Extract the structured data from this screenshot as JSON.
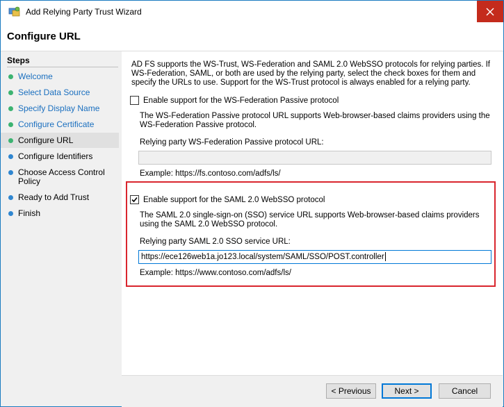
{
  "window": {
    "title": "Add Relying Party Trust Wizard"
  },
  "header": {
    "title": "Configure URL"
  },
  "sidebar": {
    "heading": "Steps",
    "steps": [
      {
        "label": "Welcome",
        "state": "done"
      },
      {
        "label": "Select Data Source",
        "state": "done"
      },
      {
        "label": "Specify Display Name",
        "state": "done"
      },
      {
        "label": "Configure Certificate",
        "state": "done"
      },
      {
        "label": "Configure URL",
        "state": "current"
      },
      {
        "label": "Configure Identifiers",
        "state": "todo"
      },
      {
        "label": "Choose Access Control Policy",
        "state": "todo"
      },
      {
        "label": "Ready to Add Trust",
        "state": "todo"
      },
      {
        "label": "Finish",
        "state": "todo"
      }
    ]
  },
  "main": {
    "intro": "AD FS supports the WS-Trust, WS-Federation and SAML 2.0 WebSSO protocols for relying parties.  If WS-Federation, SAML, or both are used by the relying party, select the check boxes for them and specify the URLs to use.  Support for the WS-Trust protocol is always enabled for a relying party.",
    "wsfed": {
      "checkbox_label": "Enable support for the WS-Federation Passive protocol",
      "checked": false,
      "description": "The WS-Federation Passive protocol URL supports Web-browser-based claims providers using the WS-Federation Passive protocol.",
      "field_label": "Relying party WS-Federation Passive protocol URL:",
      "value": "",
      "example": "Example: https://fs.contoso.com/adfs/ls/"
    },
    "saml": {
      "checkbox_label": "Enable support for the SAML 2.0 WebSSO protocol",
      "checked": true,
      "description": "The SAML 2.0 single-sign-on (SSO) service URL supports Web-browser-based claims providers using the SAML 2.0 WebSSO protocol.",
      "field_label": "Relying party SAML 2.0 SSO service URL:",
      "value": "https://ece126web1a.jo123.local/system/SAML/SSO/POST.controller",
      "example": "Example: https://www.contoso.com/adfs/ls/"
    }
  },
  "footer": {
    "previous_label": "< Previous",
    "next_label": "Next >",
    "cancel_label": "Cancel"
  },
  "colors": {
    "highlight": "#d9252d",
    "done_dot": "#3cb371",
    "todo_dot": "#2f86d0",
    "link": "#1a6fbf"
  }
}
